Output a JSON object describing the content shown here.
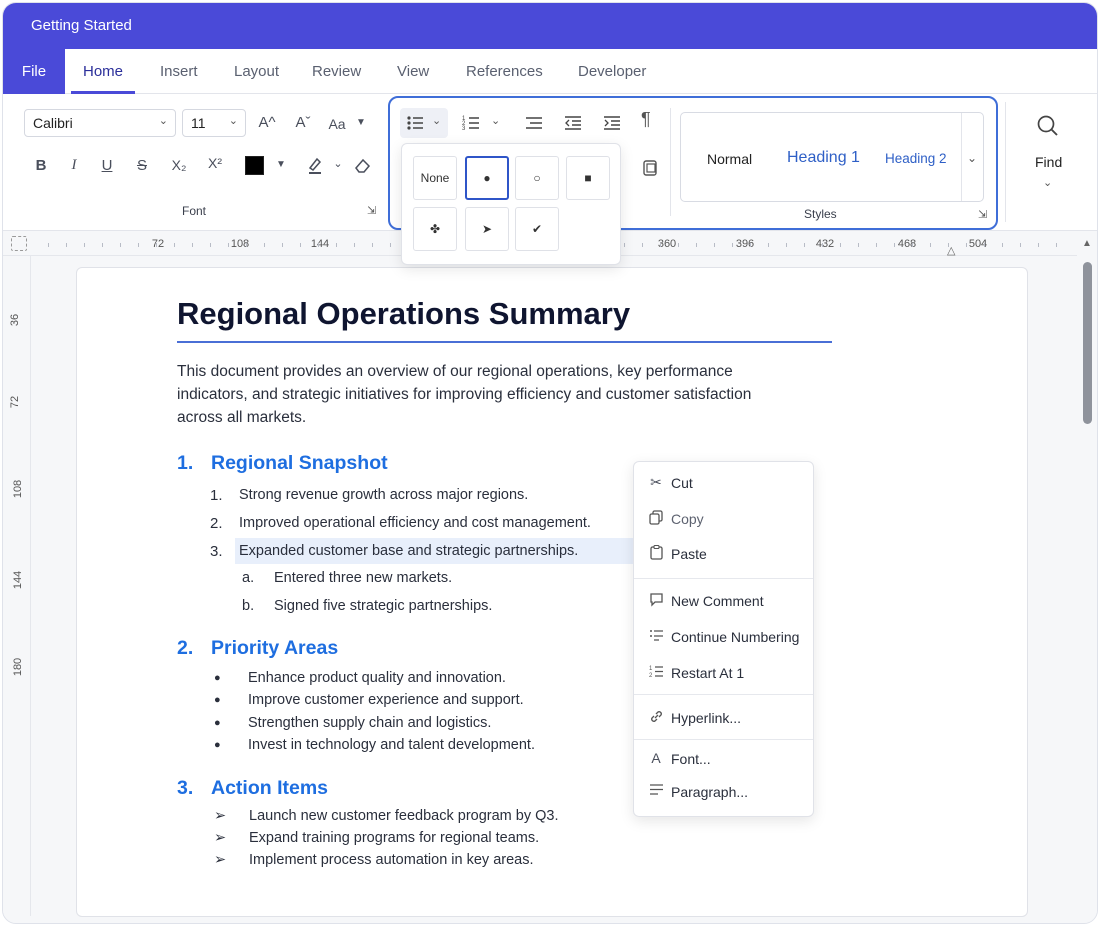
{
  "window": {
    "title": "Getting Started"
  },
  "tabs": {
    "file": "File",
    "home": "Home",
    "insert": "Insert",
    "layout": "Layout",
    "review": "Review",
    "view": "View",
    "references": "References",
    "developer": "Developer"
  },
  "font_group": {
    "font_name": "Calibri",
    "font_size": "11",
    "grow": "A^",
    "shrink": "Aˇ",
    "case": "Aa",
    "bold": "B",
    "italic": "I",
    "underline": "U",
    "strike": "S",
    "subscript": "X₂",
    "superscript": "X²",
    "font_color": "#000000",
    "label": "Font"
  },
  "styles_group": {
    "normal": "Normal",
    "heading1": "Heading 1",
    "heading2": "Heading 2",
    "label": "Styles"
  },
  "find": {
    "label": "Find"
  },
  "bullet_dropdown": {
    "none": "None",
    "options": [
      "●",
      "○",
      "■",
      "✤",
      "➤",
      "✔"
    ],
    "selected": "●"
  },
  "ruler": {
    "horizontal": [
      "72",
      "108",
      "144",
      "360",
      "396",
      "432",
      "468",
      "504"
    ],
    "vertical": [
      "36",
      "72",
      "108",
      "144",
      "180"
    ]
  },
  "document": {
    "title": "Regional Operations Summary",
    "intro": [
      "This document provides an overview of our regional operations, key performance",
      "indicators, and strategic initiatives for improving efficiency and customer satisfaction",
      "across all markets."
    ],
    "sections": [
      {
        "num": "1.",
        "heading": "Regional Snapshot",
        "items": [
          {
            "marker": "1.",
            "text": "Strong revenue growth across major regions."
          },
          {
            "marker": "2.",
            "text": "Improved operational efficiency and cost management."
          },
          {
            "marker": "3.",
            "text": "Expanded customer base and strategic partnerships."
          }
        ],
        "subitems": [
          {
            "marker": "a.",
            "text": "Entered three new markets."
          },
          {
            "marker": "b.",
            "text": "Signed five strategic partnerships."
          }
        ]
      },
      {
        "num": "2.",
        "heading": "Priority Areas",
        "items": [
          {
            "marker": "●",
            "text": "Enhance product quality and innovation."
          },
          {
            "marker": "●",
            "text": "Improve customer experience and support."
          },
          {
            "marker": "●",
            "text": "Strengthen supply chain and logistics."
          },
          {
            "marker": "●",
            "text": "Invest in technology and talent development."
          }
        ]
      },
      {
        "num": "3.",
        "heading": "Action Items",
        "items": [
          {
            "marker": "➢",
            "text": "Launch new customer feedback program by Q3."
          },
          {
            "marker": "➢",
            "text": "Expand training programs for regional teams."
          },
          {
            "marker": "➢",
            "text": "Implement process automation in key areas."
          }
        ]
      }
    ]
  },
  "context_menu": {
    "cut": "Cut",
    "copy": "Copy",
    "paste": "Paste",
    "new_comment": "New Comment",
    "continue_numbering": "Continue Numbering",
    "restart": "Restart At 1",
    "hyperlink": "Hyperlink...",
    "font": "Font...",
    "paragraph": "Paragraph..."
  },
  "colors": {
    "accent": "#4a4ad8",
    "heading": "#1e6ee0",
    "selection": "#e8effb",
    "focus": "#3f6ed8"
  }
}
